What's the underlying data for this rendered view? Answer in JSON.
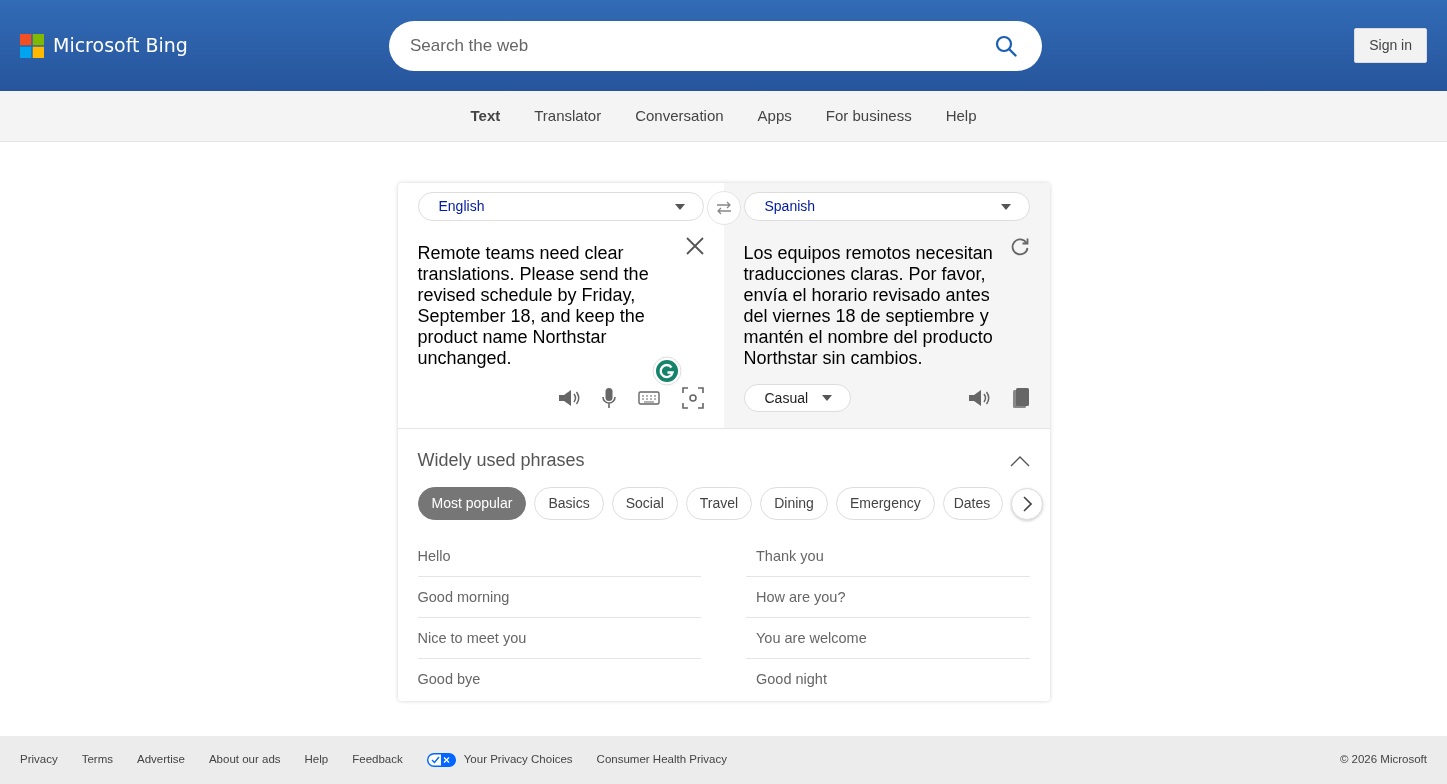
{
  "header": {
    "logo_text": "Microsoft Bing",
    "search": {
      "placeholder": "Search the web"
    },
    "sign_in": "Sign in"
  },
  "nav": [
    {
      "label": "Text",
      "selected": true
    },
    {
      "label": "Translator",
      "selected": false
    },
    {
      "label": "Conversation",
      "selected": false
    },
    {
      "label": "Apps",
      "selected": false
    },
    {
      "label": "For business",
      "selected": false
    },
    {
      "label": "Help",
      "selected": false
    }
  ],
  "translator": {
    "source_language": "English",
    "target_language": "Spanish",
    "source_text": "Remote teams need clear translations. Please send the revised schedule by Friday, September 18, and keep the product name Northstar unchanged.",
    "target_text": "Los equipos remotos necesitan traducciones claras. Por favor, envía el horario revisado antes del viernes 18 de septiembre y mantén el nombre del producto Northstar sin cambios.",
    "tone": "Casual"
  },
  "phrases": {
    "title": "Widely used phrases",
    "expanded": true,
    "categories": [
      {
        "label": "Most popular",
        "selected": true
      },
      {
        "label": "Basics",
        "selected": false
      },
      {
        "label": "Social",
        "selected": false
      },
      {
        "label": "Travel",
        "selected": false
      },
      {
        "label": "Dining",
        "selected": false
      },
      {
        "label": "Emergency",
        "selected": false
      },
      {
        "label": "Dates",
        "selected": false
      }
    ],
    "columns": [
      [
        "Hello",
        "Good morning",
        "Nice to meet you",
        "Good bye"
      ],
      [
        "Thank you",
        "How are you?",
        "You are welcome",
        "Good night"
      ]
    ]
  },
  "footer": {
    "links": [
      "Privacy",
      "Terms",
      "Advertise",
      "About our ads",
      "Help",
      "Feedback"
    ],
    "privacy_choices": "Your Privacy Choices",
    "health": "Consumer Health Privacy",
    "copyright": "© 2026 Microsoft"
  }
}
